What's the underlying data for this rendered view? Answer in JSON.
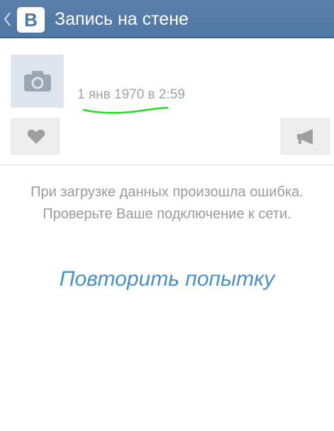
{
  "header": {
    "logo_text": "В",
    "title": "Запись на стене",
    "back_icon": "chevron-left-icon"
  },
  "post": {
    "avatar_icon": "camera-icon",
    "date": "1 янв 1970 в 2:59",
    "like_icon": "heart-icon",
    "share_icon": "megaphone-icon"
  },
  "error": {
    "message": "При загрузке данных произошла ошибка. Проверьте Ваше подключение к сети.",
    "retry_label": "Повторить попытку"
  },
  "colors": {
    "header_bg": "#4f77a4",
    "link": "#4a90c8",
    "annotation": "#22dd22"
  }
}
